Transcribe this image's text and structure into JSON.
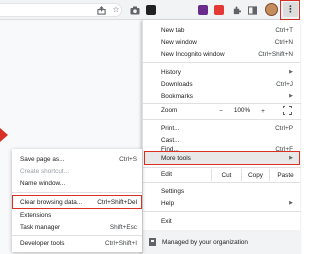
{
  "toolbar": {
    "icons": [
      "share-icon",
      "bookmark-star-icon",
      "camera-icon",
      "extension-black-icon",
      "extension-gallery-icon",
      "extension-red-icon",
      "puzzle-icon",
      "tab-icon",
      "profile-avatar",
      "menu-kebab-icon"
    ],
    "ext_colors": [
      "#202124",
      "#6a2c8c",
      "#e53935"
    ],
    "kebab_glyph": "⋮"
  },
  "menu": {
    "new_tab": {
      "label": "New tab",
      "shortcut": "Ctrl+T"
    },
    "new_window": {
      "label": "New window",
      "shortcut": "Ctrl+N"
    },
    "new_incognito": {
      "label": "New Incognito window",
      "shortcut": "Ctrl+Shift+N"
    },
    "history": {
      "label": "History"
    },
    "downloads": {
      "label": "Downloads",
      "shortcut": "Ctrl+J"
    },
    "bookmarks": {
      "label": "Bookmarks"
    },
    "zoom": {
      "label": "Zoom",
      "minus": "−",
      "value": "100%",
      "plus": "+"
    },
    "print": {
      "label": "Print...",
      "shortcut": "Ctrl+P"
    },
    "cast": {
      "label": "Cast..."
    },
    "find": {
      "label": "Find...",
      "shortcut": "Ctrl+F"
    },
    "more_tools": {
      "label": "More tools"
    },
    "edit": {
      "label": "Edit",
      "cut": "Cut",
      "copy": "Copy",
      "paste": "Paste"
    },
    "settings": {
      "label": "Settings"
    },
    "help": {
      "label": "Help"
    },
    "exit": {
      "label": "Exit"
    },
    "managed": {
      "label": "Managed by your organization"
    }
  },
  "submenu": {
    "save_page": {
      "label": "Save page as...",
      "shortcut": "Ctrl+S"
    },
    "create_shortcut": {
      "label": "Create shortcut..."
    },
    "name_window": {
      "label": "Name window..."
    },
    "clear_browsing": {
      "label": "Clear browsing data...",
      "shortcut": "Ctrl+Shift+Del"
    },
    "extensions": {
      "label": "Extensions"
    },
    "task_manager": {
      "label": "Task manager",
      "shortcut": "Shift+Esc"
    },
    "developer_tools": {
      "label": "Developer tools",
      "shortcut": "Ctrl+Shift+I"
    }
  },
  "colors": {
    "highlight_border": "#d93025",
    "menu_bg": "#ffffff",
    "hover_bg": "#e8e8e8"
  }
}
